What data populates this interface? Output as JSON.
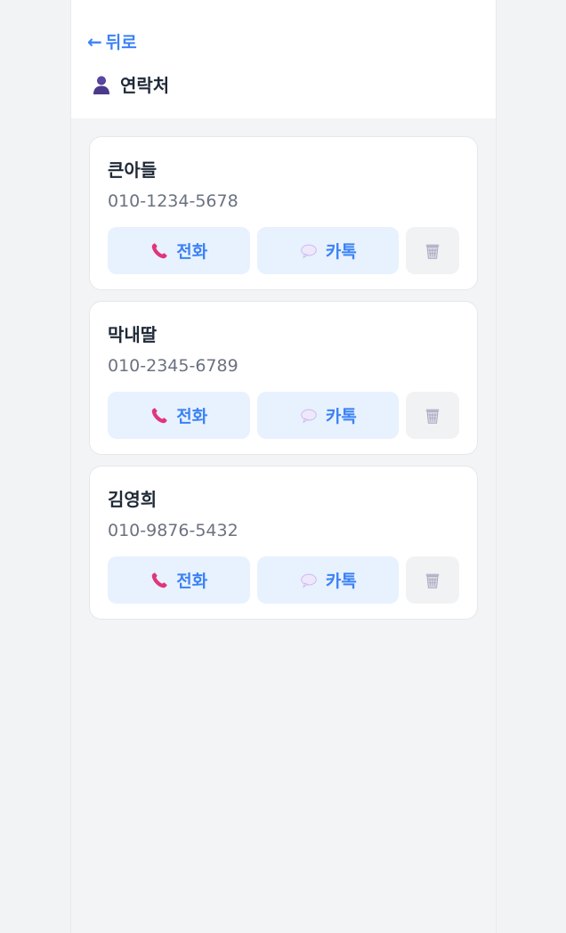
{
  "header": {
    "back_arrow": "←",
    "back_label": "뒤로",
    "title": "연락처"
  },
  "contacts": [
    {
      "name": "큰아들",
      "phone": "010-1234-5678",
      "call_label": "전화",
      "talk_label": "카톡"
    },
    {
      "name": "막내딸",
      "phone": "010-2345-6789",
      "call_label": "전화",
      "talk_label": "카톡"
    },
    {
      "name": "김영희",
      "phone": "010-9876-5432",
      "call_label": "전화",
      "talk_label": "카톡"
    }
  ],
  "icons": {
    "title": "person-icon",
    "call": "phone-icon",
    "talk": "speech-bubble-icon",
    "delete": "trash-icon"
  },
  "colors": {
    "accent": "#3b82f6",
    "call_bg": "#e8f1fe",
    "delete_bg": "#f1f2f4",
    "text_primary": "#1f2937",
    "text_secondary": "#6b7280"
  }
}
